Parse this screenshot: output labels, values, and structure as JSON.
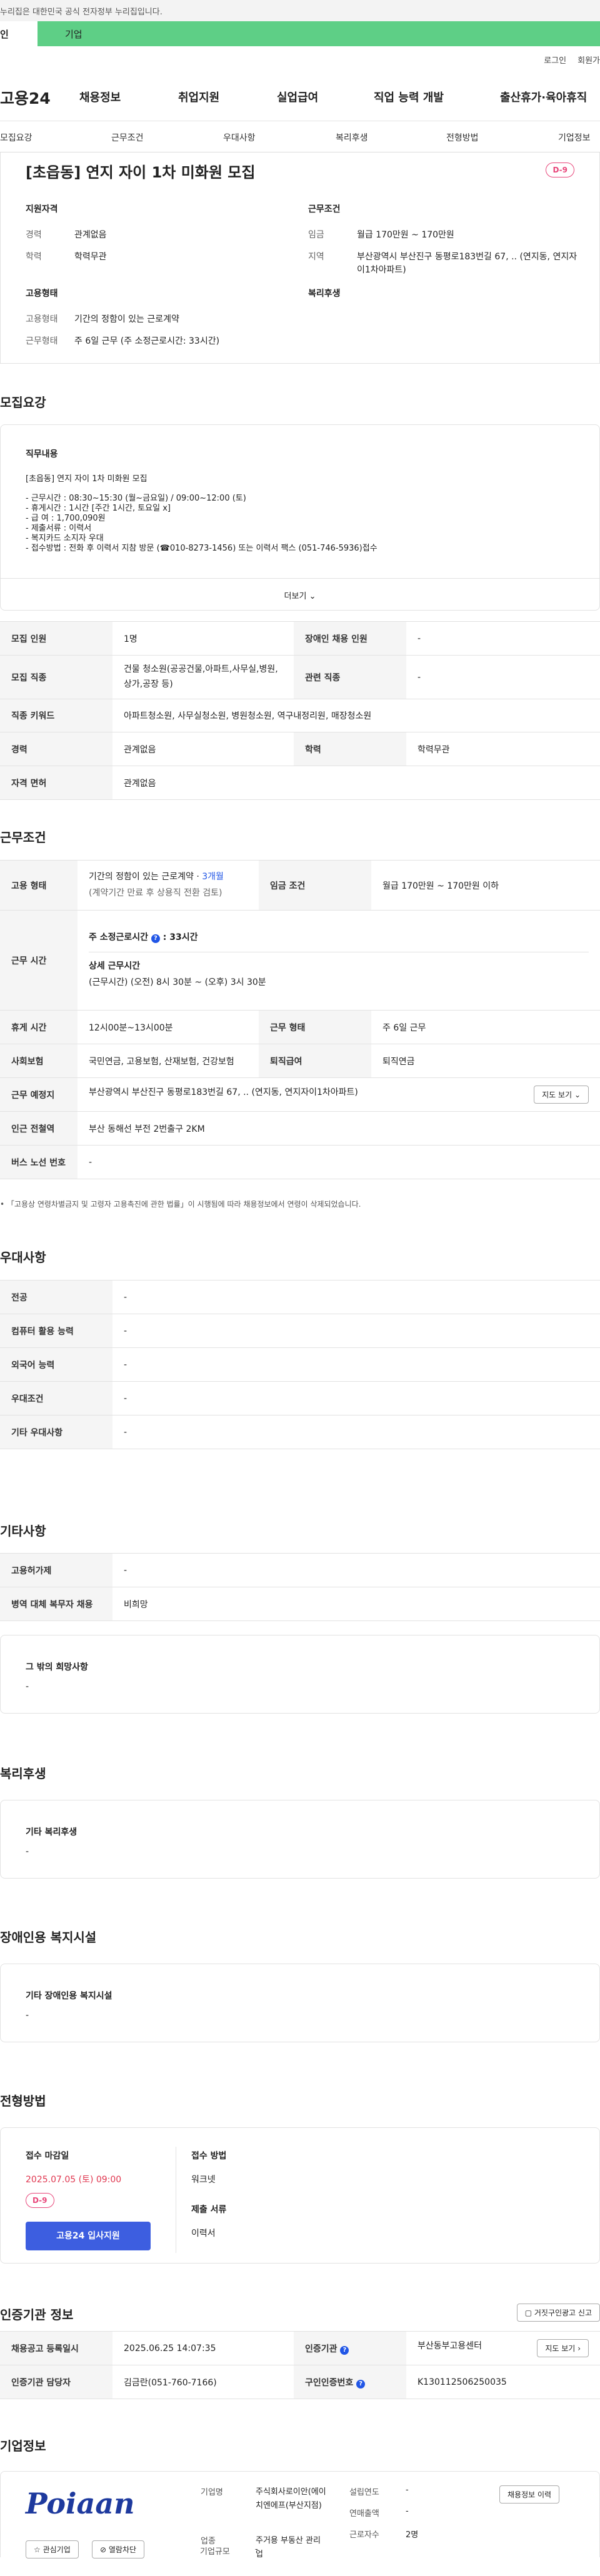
{
  "gov_banner": "누리집은 대한민국 공식 전자정부 누리집입니다.",
  "usertype": {
    "personal": "인",
    "company": "기업"
  },
  "util": {
    "login": "로그인",
    "signup": "회원가"
  },
  "gnb": {
    "logo": "고용24",
    "menus": [
      "채용정보",
      "취업지원",
      "실업급여",
      "직업 능력 개발",
      "출산휴가·육아휴직"
    ]
  },
  "subnav": [
    "모집요강",
    "근무조건",
    "우대사항",
    "복리후생",
    "전형방법",
    "기업정보"
  ],
  "header": {
    "title": "[초읍동] 연지 자이 1차 미화원 모집",
    "dday": "D-9",
    "qual_title": "지원자격",
    "qual": [
      {
        "k": "경력",
        "v": "관계없음"
      },
      {
        "k": "학력",
        "v": "학력무관"
      }
    ],
    "cond_title": "근무조건",
    "cond": [
      {
        "k": "임금",
        "v": "월급 170만원 ~ 170만원"
      },
      {
        "k": "지역",
        "v": "부산광역시 부산진구 동평로183번길 67, .. (연지동, 연지자이1차아파트)"
      }
    ],
    "emp_title": "고용형태",
    "emp": [
      {
        "k": "고용형태",
        "v": "기간의 정함이 있는 근로계약"
      },
      {
        "k": "근무형태",
        "v": "주 6일 근무 (주 소정근로시간: 33시간)"
      }
    ],
    "welfare_title": "복리후생"
  },
  "recruit": {
    "section_title": "모집요강",
    "job_title": "직무내용",
    "job_head": "[초읍동] 연지 자이 1차 미화원 모집",
    "job_lines": [
      "- 근무시간 :  08:30~15:30 (월~금요일) / 09:00~12:00 (토)",
      "- 휴게시간 :  1시간 [주간 1시간, 토요일 x]",
      "- 급        여 : 1,700,090원",
      "- 제출서류 : 이력서",
      "- 복지카드 소지자 우대",
      "- 접수방법 : 전화 후 이력서 지참 방문 (☎010-8273-1456) 또는 이력서 팩스 (051-746-5936)접수"
    ],
    "more_label": "더보기",
    "rows": {
      "count_k": "모집 인원",
      "count_v": "1명",
      "disabled_k": "장애인 채용 인원",
      "disabled_v": "-",
      "job_k": "모집 직종",
      "job_v": "건물 청소원(공공건물,아파트,사무실,병원,상가,공장 등)",
      "related_k": "관련 직종",
      "related_v": "-",
      "keyword_k": "직종 키워드",
      "keyword_v": "아파트청소원, 사무실청소원, 병원청소원, 역구내정리원, 매장청소원",
      "career_k": "경력",
      "career_v": "관계없음",
      "edu_k": "학력",
      "edu_v": "학력무관",
      "license_k": "자격 면허",
      "license_v": "관계없음"
    }
  },
  "work": {
    "section_title": "근무조건",
    "emptype_k": "고용 형태",
    "emptype_v1": "기간의 정함이 있는 근로계약 · ",
    "emptype_months": "3개월",
    "emptype_v2": "(계약기간 만료 후 상용직 전환 검토)",
    "wage_k": "임금 조건",
    "wage_v": "월급 170만원 ~ 170만원 이하",
    "hours_k": "근무 시간",
    "hours_main_label": "주 소정근로시간",
    "hours_main_value": ": 33시간",
    "hours_detail_title": "상세 근무시간",
    "hours_detail": "(근무시간) (오전) 8시 30분 ~ (오후) 3시 30분",
    "rest_k": "휴게 시간",
    "rest_v": "12시00분~13시00분",
    "worktype_k": "근무 형태",
    "worktype_v": "주 6일 근무",
    "insurance_k": "사회보험",
    "insurance_v": "국민연금, 고용보험, 산재보험, 건강보험",
    "retire_k": "퇴직급여",
    "retire_v": "퇴직연금",
    "place_k": "근무 예정지",
    "place_v": "부산광역시 부산진구 동평로183번길 67, .. (연지동, 연지자이1차아파트)",
    "map_btn": "지도 보기",
    "station_k": "인근 전철역",
    "station_v": "부산 동해선 부전 2번출구 2KM",
    "bus_k": "버스 노선 번호",
    "bus_v": "-",
    "note": "「고용상 연령차별금지 및 고령자 고용촉진에 관한 법률」이 시행됨에 따라 채용정보에서 연령이 삭제되었습니다."
  },
  "pref": {
    "section_title": "우대사항",
    "rows": [
      {
        "k": "전공",
        "v": "-"
      },
      {
        "k": "컴퓨터 활용 능력",
        "v": "-"
      },
      {
        "k": "외국어 능력",
        "v": "-"
      },
      {
        "k": "우대조건",
        "v": "-"
      },
      {
        "k": "기타 우대사항",
        "v": "-"
      }
    ]
  },
  "etc": {
    "section_title": "기타사항",
    "rows": [
      {
        "k": "고용허가제",
        "v": "-"
      },
      {
        "k": "병역 대체 복무자 채용",
        "v": "비희망"
      }
    ],
    "other_title": "그 밖의 희망사항",
    "other_v": "-"
  },
  "welfare": {
    "section_title": "복리후생",
    "box_title": "기타 복리후생",
    "box_v": "-"
  },
  "disabled": {
    "section_title": "장애인용 복지시설",
    "box_title": "기타 장애인용 복지시설",
    "box_v": "-"
  },
  "process": {
    "section_title": "전형방법",
    "deadline_title": "접수 마감일",
    "deadline": "2025.07.05 (토) 09:00",
    "dday": "D-9",
    "apply_btn": "고용24 입사지원",
    "method_title": "접수 방법",
    "method_v": "워크넷",
    "docs_title": "제출 서류",
    "docs_v": "이력서"
  },
  "agency": {
    "section_title": "인증기관 정보",
    "report_btn": "거짓구인광고 신고",
    "reg_k": "채용공고 등록일시",
    "reg_v": "2025.06.25 14:07:35",
    "org_k": "인증기관",
    "org_v": "부산동부고용센터",
    "map_btn": "지도 보기",
    "manager_k": "인증기관 담당자",
    "manager_v": "김금란(051-760-7166)",
    "id_k": "구인인증번호",
    "id_v": "K130112506250035"
  },
  "company": {
    "section_title": "기업정보",
    "logo_text": "Poiaan",
    "fav_btn": "관심기업",
    "block_btn": "열람차단",
    "name_k": "기업명",
    "name_v": "주식회사로이안(에이치엔에프(부산지점)",
    "industry_k": "업종",
    "industry_v": "주거용 부동산 관리업",
    "size_k": "기업규모",
    "size_v": "-",
    "est_k": "설립연도",
    "est_v": "-",
    "sales_k": "연매출액",
    "sales_v": "-",
    "emp_k": "근로자수",
    "emp_v": "2명",
    "jobs_btn": "채용정보 이력"
  }
}
